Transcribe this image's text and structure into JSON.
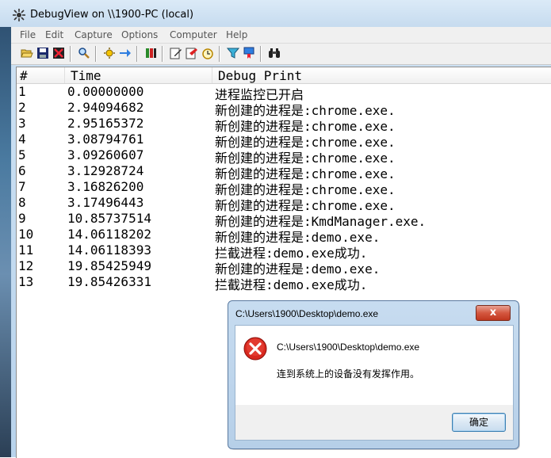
{
  "window": {
    "title": "DebugView on \\\\1900-PC (local)"
  },
  "menu": [
    "File",
    "Edit",
    "Capture",
    "Options",
    "Computer",
    "Help"
  ],
  "toolbar_icons": [
    "open-icon",
    "save-icon",
    "clear-icon",
    "find-icon",
    "capture-icon",
    "arrow-icon",
    "stack-icon",
    "edit-icon",
    "highlight-icon",
    "clock-icon",
    "filter-icon",
    "bookmark-icon",
    "binoculars-icon"
  ],
  "list": {
    "headers": {
      "num": "#",
      "time": "Time",
      "msg": "Debug Print"
    },
    "rows": [
      {
        "num": "1",
        "time": "0.00000000",
        "msg": "进程监控已开启"
      },
      {
        "num": "2",
        "time": "2.94094682",
        "msg": "新创建的进程是:chrome.exe."
      },
      {
        "num": "3",
        "time": "2.95165372",
        "msg": "新创建的进程是:chrome.exe."
      },
      {
        "num": "4",
        "time": "3.08794761",
        "msg": "新创建的进程是:chrome.exe."
      },
      {
        "num": "5",
        "time": "3.09260607",
        "msg": "新创建的进程是:chrome.exe."
      },
      {
        "num": "6",
        "time": "3.12928724",
        "msg": "新创建的进程是:chrome.exe."
      },
      {
        "num": "7",
        "time": "3.16826200",
        "msg": "新创建的进程是:chrome.exe."
      },
      {
        "num": "8",
        "time": "3.17496443",
        "msg": "新创建的进程是:chrome.exe."
      },
      {
        "num": "9",
        "time": "10.85737514",
        "msg": "新创建的进程是:KmdManager.exe."
      },
      {
        "num": "10",
        "time": "14.06118202",
        "msg": "新创建的进程是:demo.exe."
      },
      {
        "num": "11",
        "time": "14.06118393",
        "msg": "拦截进程:demo.exe成功."
      },
      {
        "num": "12",
        "time": "19.85425949",
        "msg": "新创建的进程是:demo.exe."
      },
      {
        "num": "13",
        "time": "19.85426331",
        "msg": "拦截进程:demo.exe成功."
      }
    ]
  },
  "dialog": {
    "title": "C:\\Users\\1900\\Desktop\\demo.exe",
    "path": "C:\\Users\\1900\\Desktop\\demo.exe",
    "message": "连到系统上的设备没有发挥作用。",
    "ok_label": "确定",
    "close_label": "x"
  }
}
